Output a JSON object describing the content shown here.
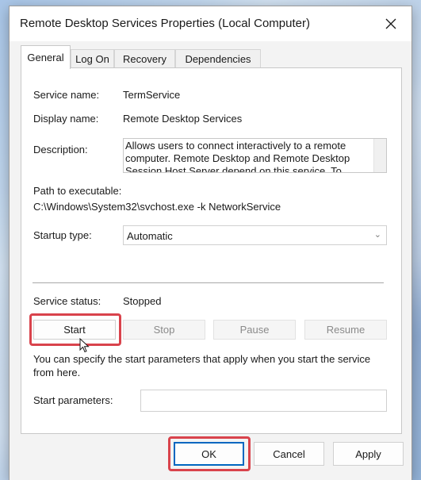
{
  "window": {
    "title": "Remote Desktop Services Properties (Local Computer)",
    "close_icon": "close-icon"
  },
  "tabs": [
    {
      "label": "General",
      "active": true
    },
    {
      "label": "Log On",
      "active": false
    },
    {
      "label": "Recovery",
      "active": false
    },
    {
      "label": "Dependencies",
      "active": false
    }
  ],
  "general": {
    "service_name_label": "Service name:",
    "service_name": "TermService",
    "display_name_label": "Display name:",
    "display_name": "Remote Desktop Services",
    "description_label": "Description:",
    "description": "Allows users to connect interactively to a remote computer. Remote Desktop and Remote Desktop Session Host Server depend on this service. To",
    "path_label": "Path to executable:",
    "path": "C:\\Windows\\System32\\svchost.exe -k NetworkService",
    "startup_type_label": "Startup type:",
    "startup_type": "Automatic",
    "service_status_label": "Service status:",
    "service_status": "Stopped",
    "buttons": {
      "start": "Start",
      "stop": "Stop",
      "pause": "Pause",
      "resume": "Resume"
    },
    "help_text": "You can specify the start parameters that apply when you start the service from here.",
    "start_params_label": "Start parameters:",
    "start_params_value": ""
  },
  "footer": {
    "ok": "OK",
    "cancel": "Cancel",
    "apply": "Apply"
  },
  "colors": {
    "highlight": "#d9434c",
    "focus": "#0067c0"
  }
}
